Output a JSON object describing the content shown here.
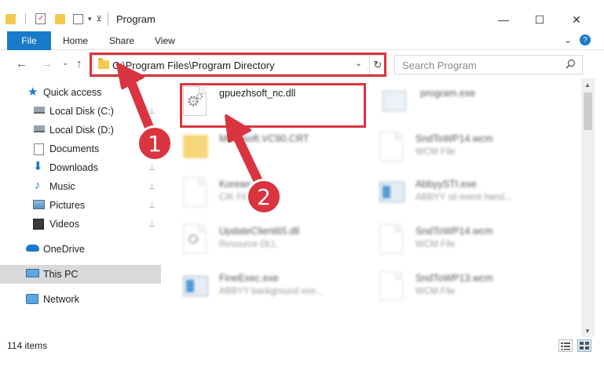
{
  "window": {
    "title": "Program",
    "minimize_glyph": "—",
    "maximize_glyph": "☐",
    "close_glyph": "✕"
  },
  "ribbon": {
    "tabs": [
      "File",
      "Home",
      "Share",
      "View"
    ],
    "expand_glyph": "⌄",
    "help_glyph": "?"
  },
  "address": {
    "path": "C:\\Program Files\\Program Directory",
    "dropdown_glyph": "⌄",
    "refresh_glyph": "↻"
  },
  "search": {
    "placeholder": "Search Program",
    "icon": "search-icon"
  },
  "nav_glyphs": {
    "back": "←",
    "forward": "→",
    "recent": "⌄",
    "up": "↑"
  },
  "sidebar": {
    "items": [
      {
        "label": "Quick access",
        "icon": "star-icon",
        "pinned": false
      },
      {
        "label": "Local Disk (C:)",
        "icon": "drive-icon",
        "pinned": true
      },
      {
        "label": "Local Disk (D:)",
        "icon": "drive-icon",
        "pinned": false
      },
      {
        "label": "Documents",
        "icon": "documents-icon",
        "pinned": true
      },
      {
        "label": "Downloads",
        "icon": "download-icon",
        "pinned": true
      },
      {
        "label": "Music",
        "icon": "music-icon",
        "pinned": true
      },
      {
        "label": "Pictures",
        "icon": "pictures-icon",
        "pinned": true
      },
      {
        "label": "Videos",
        "icon": "videos-icon",
        "pinned": true
      },
      {
        "label": "OneDrive",
        "icon": "cloud-icon",
        "pinned": false
      },
      {
        "label": "This PC",
        "icon": "pc-icon",
        "pinned": false,
        "selected": true
      },
      {
        "label": "Network",
        "icon": "network-icon",
        "pinned": false
      }
    ],
    "pin_glyph": "📌"
  },
  "files": [
    {
      "name": "gpuezhsoft_nc.dll",
      "type": "",
      "icon": "dll-gear-icon",
      "highlighted": true
    },
    {
      "name": "program.exe",
      "type": "",
      "icon": "exe-icon"
    },
    {
      "name": "Microsoft.VC90.CRT",
      "type": "",
      "icon": "folder-icon"
    },
    {
      "name": "SndToWP14.wcm",
      "type": "WCM File",
      "icon": "file-icon"
    },
    {
      "name": "Korean",
      "type": "CIK File",
      "icon": "file-icon"
    },
    {
      "name": "AbbyySTI.exe",
      "type": "ABBYY sti event hand...",
      "icon": "exe-icon"
    },
    {
      "name": "UpdateClient65.dll",
      "type": "Resource DLL",
      "icon": "dll-gear-icon"
    },
    {
      "name": "SndToWP14.wcm",
      "type": "WCM File",
      "icon": "file-icon"
    },
    {
      "name": "FineExec.exe",
      "type": "ABBYY background exe...",
      "icon": "exe-icon"
    },
    {
      "name": "SndToWP13.wcm",
      "type": "WCM File",
      "icon": "file-icon"
    }
  ],
  "status": {
    "item_count": "114 items"
  },
  "callouts": [
    "1",
    "2"
  ],
  "colors": {
    "accent": "#1979ca",
    "highlight": "#d9343f",
    "folder": "#f3c94f"
  }
}
